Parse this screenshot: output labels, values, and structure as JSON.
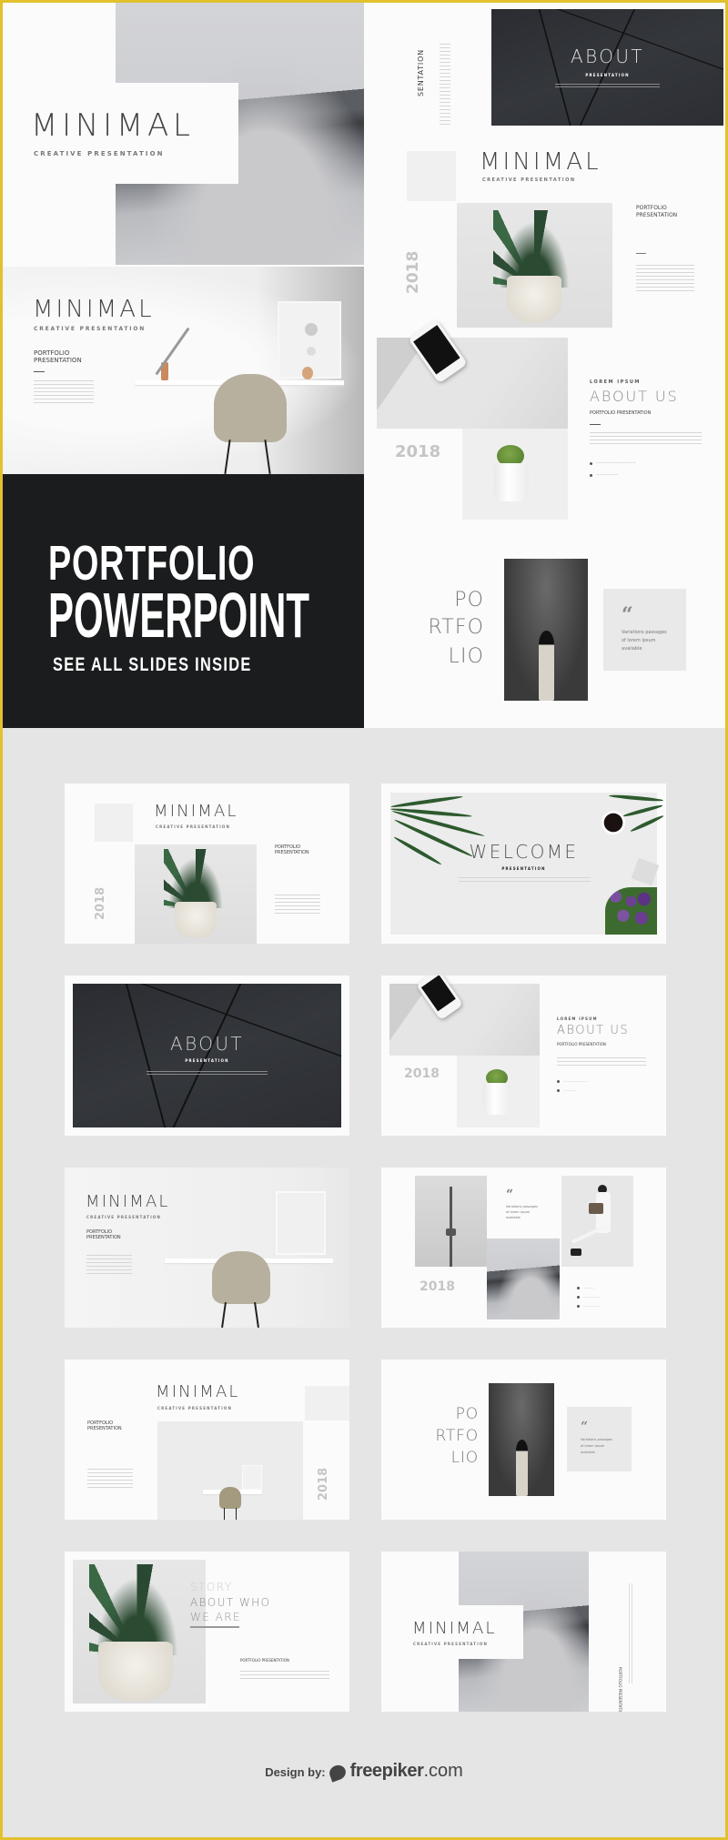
{
  "hero": {
    "cover_slide": {
      "title": "MINIMAL",
      "subtitle": "CREATIVE PRESENTATION"
    },
    "desk_slide": {
      "title": "MINIMAL",
      "subtitle": "CREATIVE PRESENTATION",
      "heading_line1": "PORTFOLIO",
      "heading_line2": "PRESENTATION"
    },
    "banner": {
      "line1": "PORTFOLIO",
      "line2": "POWERPOINT",
      "tagline": "SEE ALL SLIDES INSIDE"
    },
    "about_dark_slide": {
      "side_label": "SENTATION",
      "title": "ABOUT",
      "subtitle": "PRESENTATION"
    },
    "plant_slide": {
      "title": "MINIMAL",
      "subtitle": "CREATIVE PRESENTATION",
      "year": "2018",
      "heading_line1": "PORTFOLIO",
      "heading_line2": "PRESENTATION"
    },
    "about_us_slide": {
      "eyebrow": "LOREM IPSUM",
      "title": "ABOUT US",
      "subtitle": "PORTFOLIO PRESENTATION",
      "year": "2018"
    },
    "portfolio_slide": {
      "line1": "PO",
      "line2": "RTFO",
      "line3": "LIO",
      "quote_mark": "“",
      "quote_line1": "Variations passages",
      "quote_line2": "of lorem ipsum",
      "quote_line3": "available"
    }
  },
  "grid": {
    "s1": {
      "title": "MINIMAL",
      "subtitle": "CREATIVE PRESENTATION",
      "year": "2018",
      "heading_line1": "PORTFOLIO",
      "heading_line2": "PRESENTATION"
    },
    "s2": {
      "title": "WELCOME",
      "subtitle": "PRESENTATION"
    },
    "s3": {
      "title": "ABOUT",
      "subtitle": "PRESENTATION"
    },
    "s4": {
      "eyebrow": "LOREM IPSUM",
      "title": "ABOUT US",
      "subtitle": "PORTFOLIO PRESENTATION",
      "year": "2018"
    },
    "s5": {
      "title": "MINIMAL",
      "subtitle": "CREATIVE PRESENTATION",
      "heading_line1": "PORTFOLIO",
      "heading_line2": "PRESENTATION"
    },
    "s6": {
      "quote_mark": "“",
      "quote_line1": "Variations passages",
      "quote_line2": "of lorem ipsum",
      "quote_line3": "available",
      "year": "2018"
    },
    "s7": {
      "title": "MINIMAL",
      "subtitle": "CREATIVE PRESENTATION",
      "year": "2018",
      "heading_line1": "PORTFOLIO",
      "heading_line2": "PRESENTATION"
    },
    "s8": {
      "line1": "PO",
      "line2": "RTFO",
      "line3": "LIO",
      "quote_mark": "“",
      "quote_line1": "Variations passages",
      "quote_line2": "of lorem ipsum",
      "quote_line3": "available"
    },
    "s9": {
      "line1": "STORY",
      "line2": "ABOUT WHO",
      "line3": "WE ARE",
      "subtitle": "PORTFOLIO PRESENTATION"
    },
    "s10": {
      "title": "MINIMAL",
      "subtitle": "CREATIVE PRESENTATION",
      "side_label": "PORTFOLIO PRESENTATION"
    }
  },
  "footer": {
    "design_by": "Design by:",
    "brand": "freepiker",
    "domain": ".com"
  },
  "colors": {
    "frame": "#e2c12d",
    "background": "#e5e5e5",
    "banner": "#1b1c1e"
  }
}
